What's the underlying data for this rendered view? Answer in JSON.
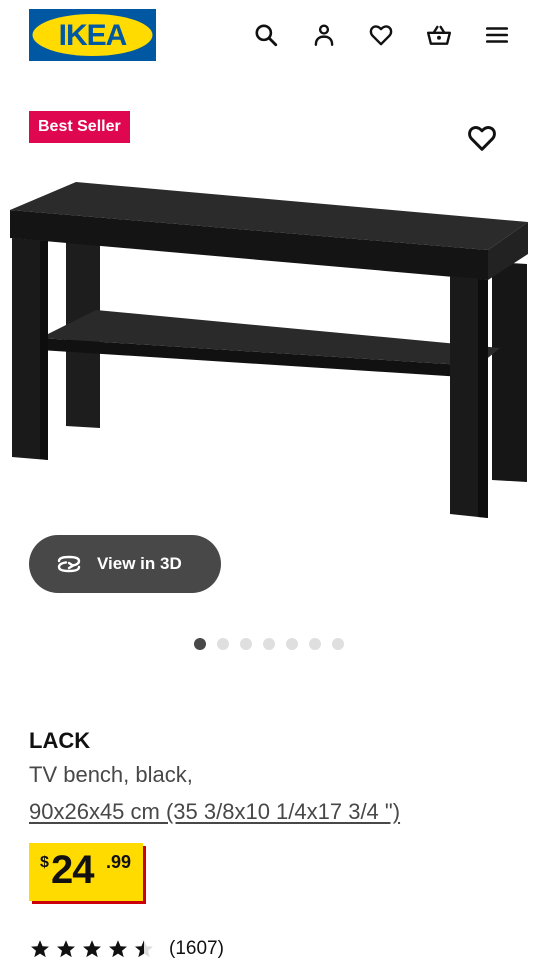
{
  "header": {
    "logo_text": "IKEA",
    "icons": [
      "search-icon",
      "account-icon",
      "heart-icon",
      "basket-icon",
      "menu-icon"
    ]
  },
  "product": {
    "badge": "Best Seller",
    "image_alt": "LACK TV bench, black",
    "view_in_3d_label": "View in 3D",
    "gallery": {
      "total": 7,
      "active": 1
    },
    "name": "LACK",
    "description": "TV bench, black,",
    "dimensions": "90x26x45 cm (35 3/8x10 1/4x17 3/4 \")",
    "price": {
      "currency": "$",
      "whole": "24",
      "cents": ".99"
    },
    "rating": {
      "value": 4.5,
      "max": 5,
      "reviews": "(1607)"
    }
  },
  "colors": {
    "ikea_blue": "#0058a3",
    "ikea_yellow": "#ffdb00",
    "badge_red": "#e00751",
    "price_shadow": "#cc0008"
  }
}
